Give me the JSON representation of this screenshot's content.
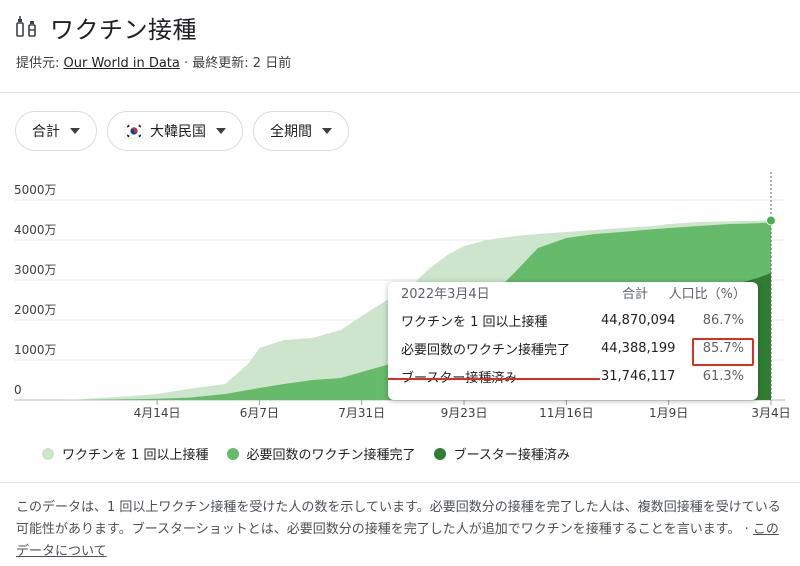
{
  "header": {
    "title": "ワクチン接種",
    "source_prefix": "提供元: ",
    "source_link": "Our World in Data",
    "updated": " · 最終更新: 2 日前"
  },
  "filters": {
    "metric": "合計",
    "country": "大韓民国",
    "period": "全期間"
  },
  "tooltip": {
    "date": "2022年3月4日",
    "col_total": "合計",
    "col_pct": "人口比（%）",
    "rows": [
      {
        "label": "ワクチンを 1 回以上接種",
        "value": "44,870,094",
        "pct": "86.7%"
      },
      {
        "label": "必要回数のワクチン接種完了",
        "value": "44,388,199",
        "pct": "85.7%"
      },
      {
        "label": "ブースター接種済み",
        "value": "31,746,117",
        "pct": "61.3%"
      }
    ]
  },
  "legend": [
    {
      "label": "ワクチンを 1 回以上接種",
      "color": "#cce5cc"
    },
    {
      "label": "必要回数のワクチン接種完了",
      "color": "#66bb6a"
    },
    {
      "label": "ブースター接種済み",
      "color": "#2e7d32"
    }
  ],
  "note": {
    "text": "このデータは、1 回以上ワクチン接種を受けた人の数を示しています。必要回数分の接種を完了した人は、複数回接種を受けている可能性があります。ブースターショットとは、必要回数分の接種を完了した人が追加でワクチンを接種することを言います。 · ",
    "link": "このデータについて"
  },
  "chart_data": {
    "type": "area",
    "x_tick_labels": [
      "4月14日",
      "6月7日",
      "7月31日",
      "9月23日",
      "11月16日",
      "1月9日",
      "3月4日"
    ],
    "y_tick_labels": [
      "0",
      "1000万",
      "2000万",
      "3000万",
      "4000万",
      "5000万"
    ],
    "ylim": [
      0,
      50000000
    ],
    "grid": true,
    "x": [
      "2021-02-26",
      "2021-03-15",
      "2021-04-01",
      "2021-04-14",
      "2021-05-01",
      "2021-05-20",
      "2021-06-01",
      "2021-06-07",
      "2021-06-20",
      "2021-07-05",
      "2021-07-20",
      "2021-07-31",
      "2021-08-15",
      "2021-08-25",
      "2021-09-05",
      "2021-09-15",
      "2021-09-23",
      "2021-10-05",
      "2021-10-20",
      "2021-11-01",
      "2021-11-16",
      "2021-12-01",
      "2021-12-15",
      "2022-01-01",
      "2022-01-09",
      "2022-01-25",
      "2022-02-10",
      "2022-02-25",
      "2022-03-04"
    ],
    "series": [
      {
        "name": "ワクチンを 1 回以上接種",
        "color": "#cce5cc",
        "values": [
          0,
          500000,
          1000000,
          1500000,
          2800000,
          4000000,
          9000000,
          13000000,
          15000000,
          15500000,
          17500000,
          21000000,
          25500000,
          28000000,
          33000000,
          36500000,
          38500000,
          40000000,
          41000000,
          41500000,
          42000000,
          42500000,
          43000000,
          43500000,
          44000000,
          44500000,
          44700000,
          44800000,
          44870094
        ]
      },
      {
        "name": "必要回数のワクチン接種完了",
        "color": "#66bb6a",
        "values": [
          0,
          100000,
          200000,
          300000,
          600000,
          1500000,
          2500000,
          3000000,
          4000000,
          5000000,
          5500000,
          7000000,
          9000000,
          10000000,
          12000000,
          15000000,
          19000000,
          25000000,
          32000000,
          38000000,
          40500000,
          41500000,
          42000000,
          42700000,
          43000000,
          43500000,
          44000000,
          44200000,
          44388199
        ]
      },
      {
        "name": "ブースター接種済み",
        "color": "#2e7d32",
        "values": [
          0,
          0,
          0,
          0,
          0,
          0,
          0,
          0,
          0,
          0,
          0,
          0,
          0,
          0,
          0,
          0,
          0,
          0,
          100000,
          500000,
          1500000,
          4000000,
          8000000,
          15000000,
          20000000,
          25000000,
          28500000,
          30500000,
          31746117
        ]
      }
    ]
  }
}
